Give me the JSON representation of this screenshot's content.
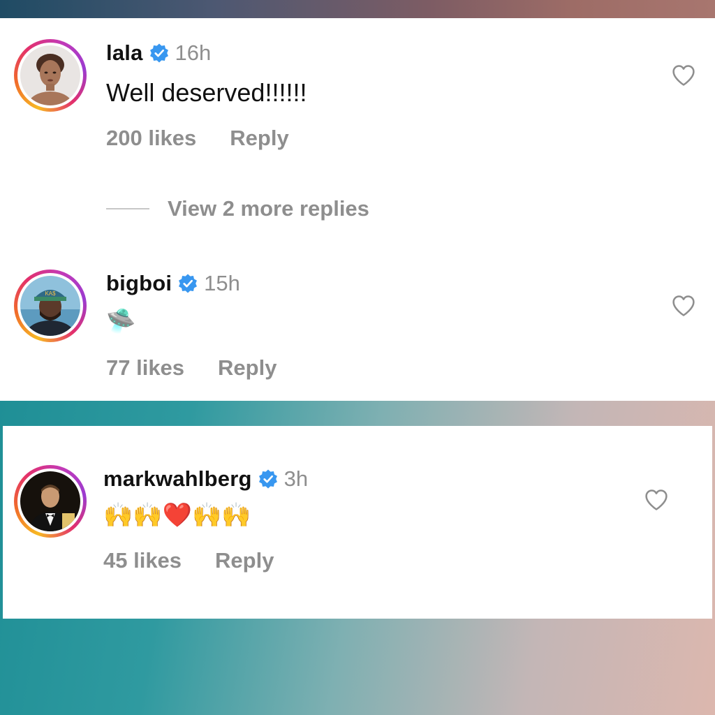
{
  "comments": [
    {
      "username": "lala",
      "timestamp": "16h",
      "text": "Well deserved!!!!!!",
      "likes": "200 likes",
      "reply_label": "Reply"
    },
    {
      "username": "bigboi",
      "timestamp": "15h",
      "text": "🛸",
      "likes": "77 likes",
      "reply_label": "Reply"
    },
    {
      "username": "markwahlberg",
      "timestamp": "3h",
      "text": "🙌🙌❤️🙌🙌",
      "likes": "45 likes",
      "reply_label": "Reply"
    }
  ],
  "view_more_replies": "View 2 more replies",
  "icons": {
    "verified": "verified-badge-icon",
    "heart": "heart-outline-icon"
  },
  "colors": {
    "verified_blue": "#3897f0",
    "meta_gray": "#8e8e8e"
  }
}
